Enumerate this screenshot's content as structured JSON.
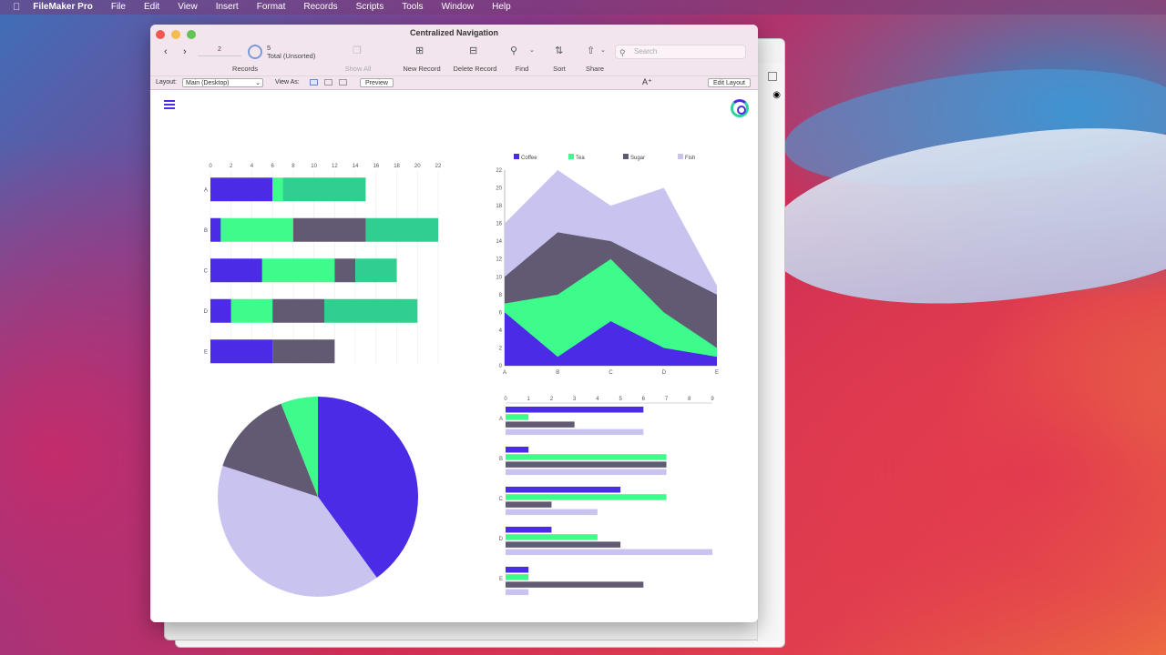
{
  "menubar": {
    "items": [
      "FileMaker Pro",
      "File",
      "Edit",
      "View",
      "Insert",
      "Format",
      "Records",
      "Scripts",
      "Tools",
      "Window",
      "Help"
    ]
  },
  "window": {
    "title": "Centralized Navigation"
  },
  "toolbar": {
    "record_number": "2",
    "found_count": "5",
    "found_status": "Total (Unsorted)",
    "records_label": "Records",
    "show_all": "Show All",
    "new_record": "New Record",
    "delete_record": "Delete Record",
    "find": "Find",
    "sort": "Sort",
    "share": "Share",
    "search_placeholder": "Search"
  },
  "layoutbar": {
    "layout_label": "Layout:",
    "layout_value": "Main (Desktop)",
    "view_as_label": "View As:",
    "preview": "Preview",
    "font_glyph": "A⁺",
    "edit_layout": "Edit Layout"
  },
  "colors": {
    "coffee": "#4b2be6",
    "tea": "#3dfc8c",
    "tea_dark": "#31cf8f",
    "sugar": "#625a72",
    "fish": "#c9c3ef"
  },
  "chart_data": [
    {
      "type": "bar",
      "orientation": "horizontal",
      "stacked": true,
      "categories": [
        "A",
        "B",
        "C",
        "D",
        "E"
      ],
      "xticks": [
        0,
        2,
        4,
        6,
        8,
        10,
        12,
        14,
        16,
        18,
        20,
        22
      ],
      "xlim": [
        0,
        22
      ],
      "series": [
        {
          "values": [
            6,
            1,
            5,
            2,
            6
          ]
        },
        {
          "values": [
            1,
            7,
            7,
            4,
            0
          ]
        },
        {
          "values": [
            0,
            7,
            2,
            5,
            6
          ]
        },
        {
          "values": [
            8,
            7,
            4,
            9,
            0
          ]
        }
      ]
    },
    {
      "type": "area",
      "stacked": true,
      "categories": [
        "A",
        "B",
        "C",
        "D",
        "E"
      ],
      "yticks": [
        0,
        2,
        4,
        6,
        8,
        10,
        12,
        14,
        16,
        18,
        20,
        22
      ],
      "ylim": [
        0,
        22
      ],
      "legend_position": "top",
      "series": [
        {
          "name": "Coffee",
          "values": [
            6,
            1,
            5,
            2,
            1
          ]
        },
        {
          "name": "Tea",
          "values": [
            1,
            7,
            7,
            4,
            1
          ]
        },
        {
          "name": "Sugar",
          "values": [
            3,
            7,
            2,
            5,
            6
          ]
        },
        {
          "name": "Fish",
          "values": [
            6,
            7,
            4,
            9,
            1
          ]
        }
      ]
    },
    {
      "type": "pie",
      "slices": [
        {
          "value": 40
        },
        {
          "value": 40
        },
        {
          "value": 14
        },
        {
          "value": 6
        }
      ]
    },
    {
      "type": "bar",
      "orientation": "horizontal",
      "grouped": true,
      "categories": [
        "A",
        "B",
        "C",
        "D",
        "E"
      ],
      "xticks": [
        0,
        1,
        2,
        3,
        4,
        5,
        6,
        7,
        8,
        9
      ],
      "xlim": [
        0,
        9
      ],
      "series": [
        {
          "values": [
            6,
            1,
            5,
            2,
            1
          ]
        },
        {
          "values": [
            1,
            7,
            7,
            4,
            1
          ]
        },
        {
          "values": [
            3,
            7,
            2,
            5,
            6
          ]
        },
        {
          "values": [
            6,
            7,
            4,
            9,
            1
          ]
        }
      ]
    }
  ]
}
